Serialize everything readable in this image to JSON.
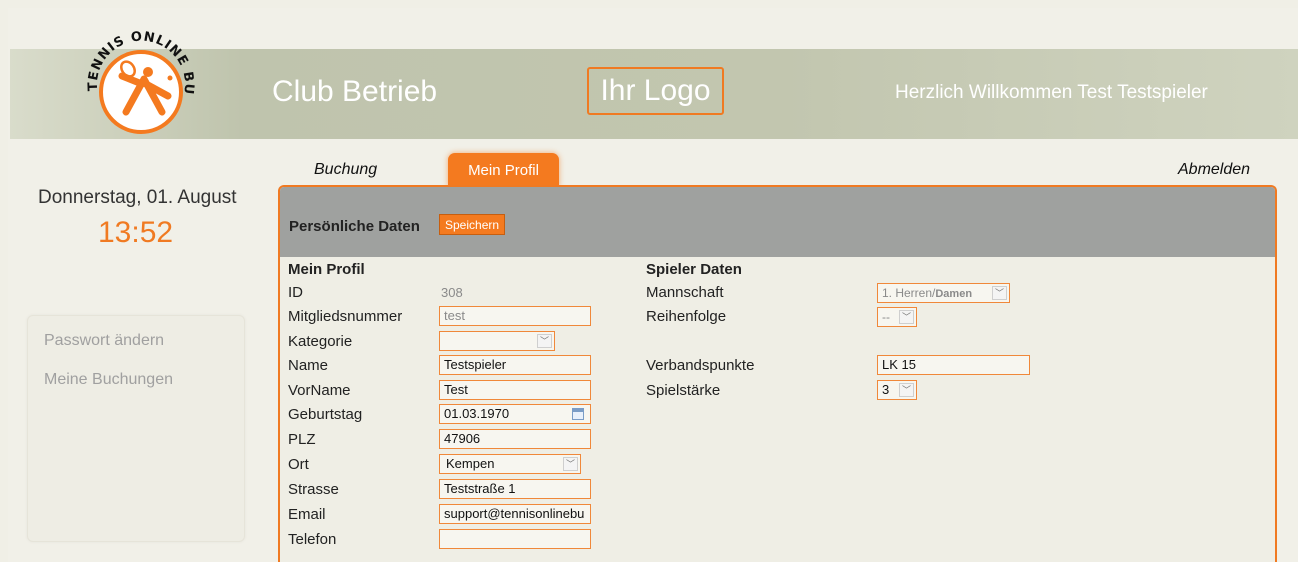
{
  "header": {
    "logo_lines": [
      "TENNIS",
      "ONLINE",
      "BUCHEN"
    ],
    "title": "Club Betrieb",
    "logo_placeholder": "Ihr Logo",
    "welcome": "Herzlich Willkommen Test Testspieler"
  },
  "sidebar": {
    "date": "Donnerstag, 01. August",
    "time": "13:52",
    "links": [
      {
        "label": "Passwort ändern"
      },
      {
        "label": "Meine Buchungen"
      }
    ]
  },
  "tabs": {
    "buchung": "Buchung",
    "profil": "Mein Profil",
    "abmelden": "Abmelden"
  },
  "panel": {
    "title": "Persönliche Daten",
    "save_label": "Speichern"
  },
  "profile": {
    "section_title": "Mein Profil",
    "id_label": "ID",
    "id_value": "308",
    "mitgliedsnummer_label": "Mitgliedsnummer",
    "mitgliedsnummer_value": "test",
    "kategorie_label": "Kategorie",
    "kategorie_value": "",
    "name_label": "Name",
    "name_value": "Testspieler",
    "vorname_label": "VorName",
    "vorname_value": "Test",
    "geburtstag_label": "Geburtstag",
    "geburtstag_value": "01.03.1970",
    "plz_label": "PLZ",
    "plz_value": "47906",
    "ort_label": "Ort",
    "ort_value": "Kempen",
    "strasse_label": "Strasse",
    "strasse_value": "Teststraße 1",
    "email_label": "Email",
    "email_value": "support@tennisonlinebu",
    "telefon_label": "Telefon",
    "telefon_value": ""
  },
  "spieler": {
    "section_title": "Spieler Daten",
    "mannschaft_label": "Mannschaft",
    "mannschaft_value_1": "1. Herren/",
    "mannschaft_value_2": "Damen",
    "reihenfolge_label": "Reihenfolge",
    "reihenfolge_value": "--",
    "verbandspunkte_label": "Verbandspunkte",
    "verbandspunkte_value": "LK 15",
    "spielstaerke_label": "Spielstärke",
    "spielstaerke_value": "3"
  },
  "colors": {
    "accent": "#f47a1f",
    "header_band": "#c2c6af",
    "panel_header": "#9fa19f",
    "background": "#f0efe6"
  },
  "icons": [
    "tennis-logo-icon",
    "chevron-down-icon",
    "calendar-icon"
  ]
}
